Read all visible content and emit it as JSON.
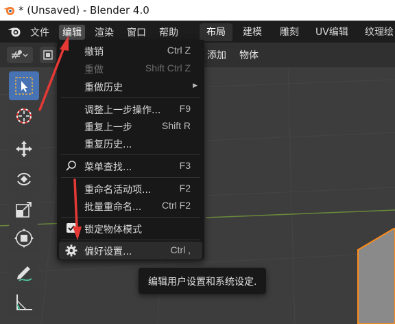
{
  "window": {
    "title": "* (Unsaved) - Blender 4.0"
  },
  "menubar": {
    "items": [
      "文件",
      "编辑",
      "渲染",
      "窗口",
      "帮助"
    ],
    "active_index": 1
  },
  "workspaces": {
    "tabs": [
      "布局",
      "建模",
      "雕刻",
      "UV编辑",
      "纹理绘"
    ],
    "active_index": 0
  },
  "header2": {
    "items": [
      "添加",
      "物体"
    ]
  },
  "edit_menu": {
    "items": [
      {
        "label": "撤销",
        "shortcut": "Ctrl Z",
        "enabled": true
      },
      {
        "label": "重做",
        "shortcut": "Shift Ctrl Z",
        "enabled": false
      },
      {
        "label": "重做历史",
        "submenu": true,
        "enabled": true
      },
      {
        "label": "调整上一步操作...",
        "shortcut": "F9",
        "enabled": true
      },
      {
        "label": "重复上一步",
        "shortcut": "Shift R",
        "enabled": true
      },
      {
        "label": "重复历史...",
        "enabled": true
      },
      {
        "label": "菜单查找...",
        "shortcut": "F3",
        "icon": "search-icon",
        "enabled": true
      },
      {
        "label": "重命名活动项...",
        "shortcut": "F2",
        "enabled": true
      },
      {
        "label": "批量重命名...",
        "shortcut": "Ctrl F2",
        "enabled": true
      },
      {
        "label": "锁定物体模式",
        "checkbox": true,
        "checked": true,
        "enabled": true
      },
      {
        "label": "偏好设置...",
        "shortcut": "Ctrl ,",
        "icon": "gear-icon",
        "enabled": true,
        "highlighted": true
      }
    ]
  },
  "tooltip": {
    "text": "编辑用户设置和系统设定."
  },
  "colors": {
    "accent": "#4772b3",
    "annotation_arrow": "#e53935",
    "object_outline": "#ff8c1a",
    "menu_bg": "#181818"
  }
}
